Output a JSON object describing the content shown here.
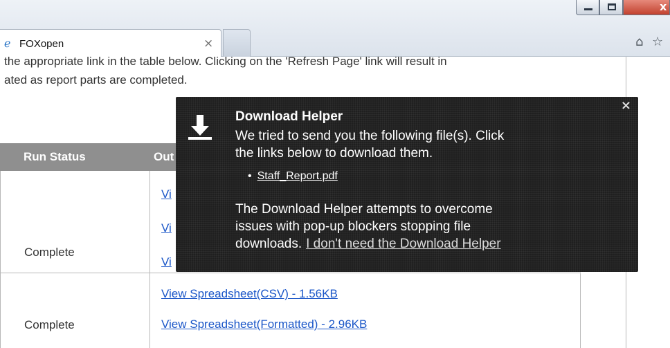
{
  "browser": {
    "tab_title": "FOXopen",
    "tab_close": "×",
    "new_tab": "",
    "window_close": "x",
    "icons": [
      "ie-favicon-icon",
      "home-icon",
      "star-icon"
    ]
  },
  "intro": {
    "line1": "the appropriate link in the table below. Clicking on the 'Refresh Page' link will result in",
    "line2": "ated as report parts are completed."
  },
  "table": {
    "headers": [
      "Run Status",
      "Out"
    ],
    "rows": [
      {
        "status": "Complete",
        "links": [
          "Vi",
          "Vi",
          "Vi"
        ]
      },
      {
        "status": "Complete",
        "links": [
          "View Spreadsheet(CSV) - 1.56KB",
          "View Spreadsheet(Formatted) - 2.96KB"
        ]
      }
    ]
  },
  "helper": {
    "close": "×",
    "title": "Download Helper",
    "line1": "We tried to send you the following file(s). Click",
    "line2": "the links below to download them.",
    "file": "Staff_Report.pdf",
    "line3": "The Download Helper attempts to overcome",
    "line4": "issues with pop-up blockers stopping file",
    "line5": "downloads.",
    "dismiss": "I don't need the Download Helper"
  }
}
